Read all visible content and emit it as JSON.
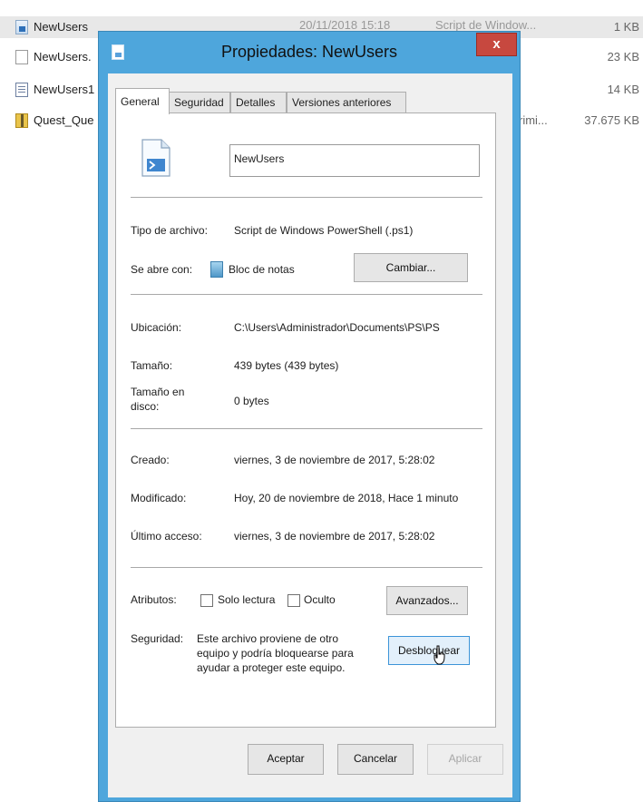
{
  "explorer": {
    "rows": [
      {
        "name": "NewUsers",
        "date": "20/11/2018 15:18",
        "type": "Script de Window...",
        "size": "1 KB",
        "icon": "powershell-file-icon"
      },
      {
        "name": "NewUsers.",
        "size": "23 KB",
        "icon": "document-file-icon"
      },
      {
        "name": "NewUsers1",
        "size": "14 KB",
        "icon": "text-file-icon"
      },
      {
        "name": "Quest_Que",
        "type_fragment": "rimi...",
        "size": "37.675 KB",
        "icon": "zip-folder-icon"
      }
    ]
  },
  "dialog": {
    "title": "Propiedades: NewUsers",
    "close_label": "x",
    "tabs": [
      "General",
      "Seguridad",
      "Detalles",
      "Versiones anteriores"
    ],
    "filename": "NewUsers",
    "file_type": {
      "label": "Tipo de archivo:",
      "value": "Script de Windows PowerShell (.ps1)"
    },
    "opens_with": {
      "label": "Se abre con:",
      "value": "Bloc de notas",
      "button": "Cambiar..."
    },
    "location": {
      "label": "Ubicación:",
      "value": "C:\\Users\\Administrador\\Documents\\PS\\PS"
    },
    "size": {
      "label": "Tamaño:",
      "value": "439 bytes (439 bytes)"
    },
    "size_on_disk": {
      "label_line1": "Tamaño en",
      "label_line2": "disco:",
      "value": "0 bytes"
    },
    "created": {
      "label": "Creado:",
      "value": "viernes, 3 de noviembre de 2017, 5:28:02"
    },
    "modified": {
      "label": "Modificado:",
      "value": "Hoy, 20 de noviembre de 2018, Hace 1 minuto"
    },
    "accessed": {
      "label": "Último acceso:",
      "value": "viernes, 3 de noviembre de 2017, 5:28:02"
    },
    "attributes": {
      "label": "Atributos:",
      "read_only": "Solo lectura",
      "hidden": "Oculto",
      "advanced_button": "Avanzados..."
    },
    "security": {
      "label": "Seguridad:",
      "text_line1": "Este archivo proviene de otro",
      "text_line2": "equipo y podría bloquearse para",
      "text_line3": "ayudar a proteger este equipo.",
      "unblock_button": "Desbloquear"
    },
    "buttons": {
      "ok": "Aceptar",
      "cancel": "Cancelar",
      "apply": "Aplicar"
    }
  }
}
